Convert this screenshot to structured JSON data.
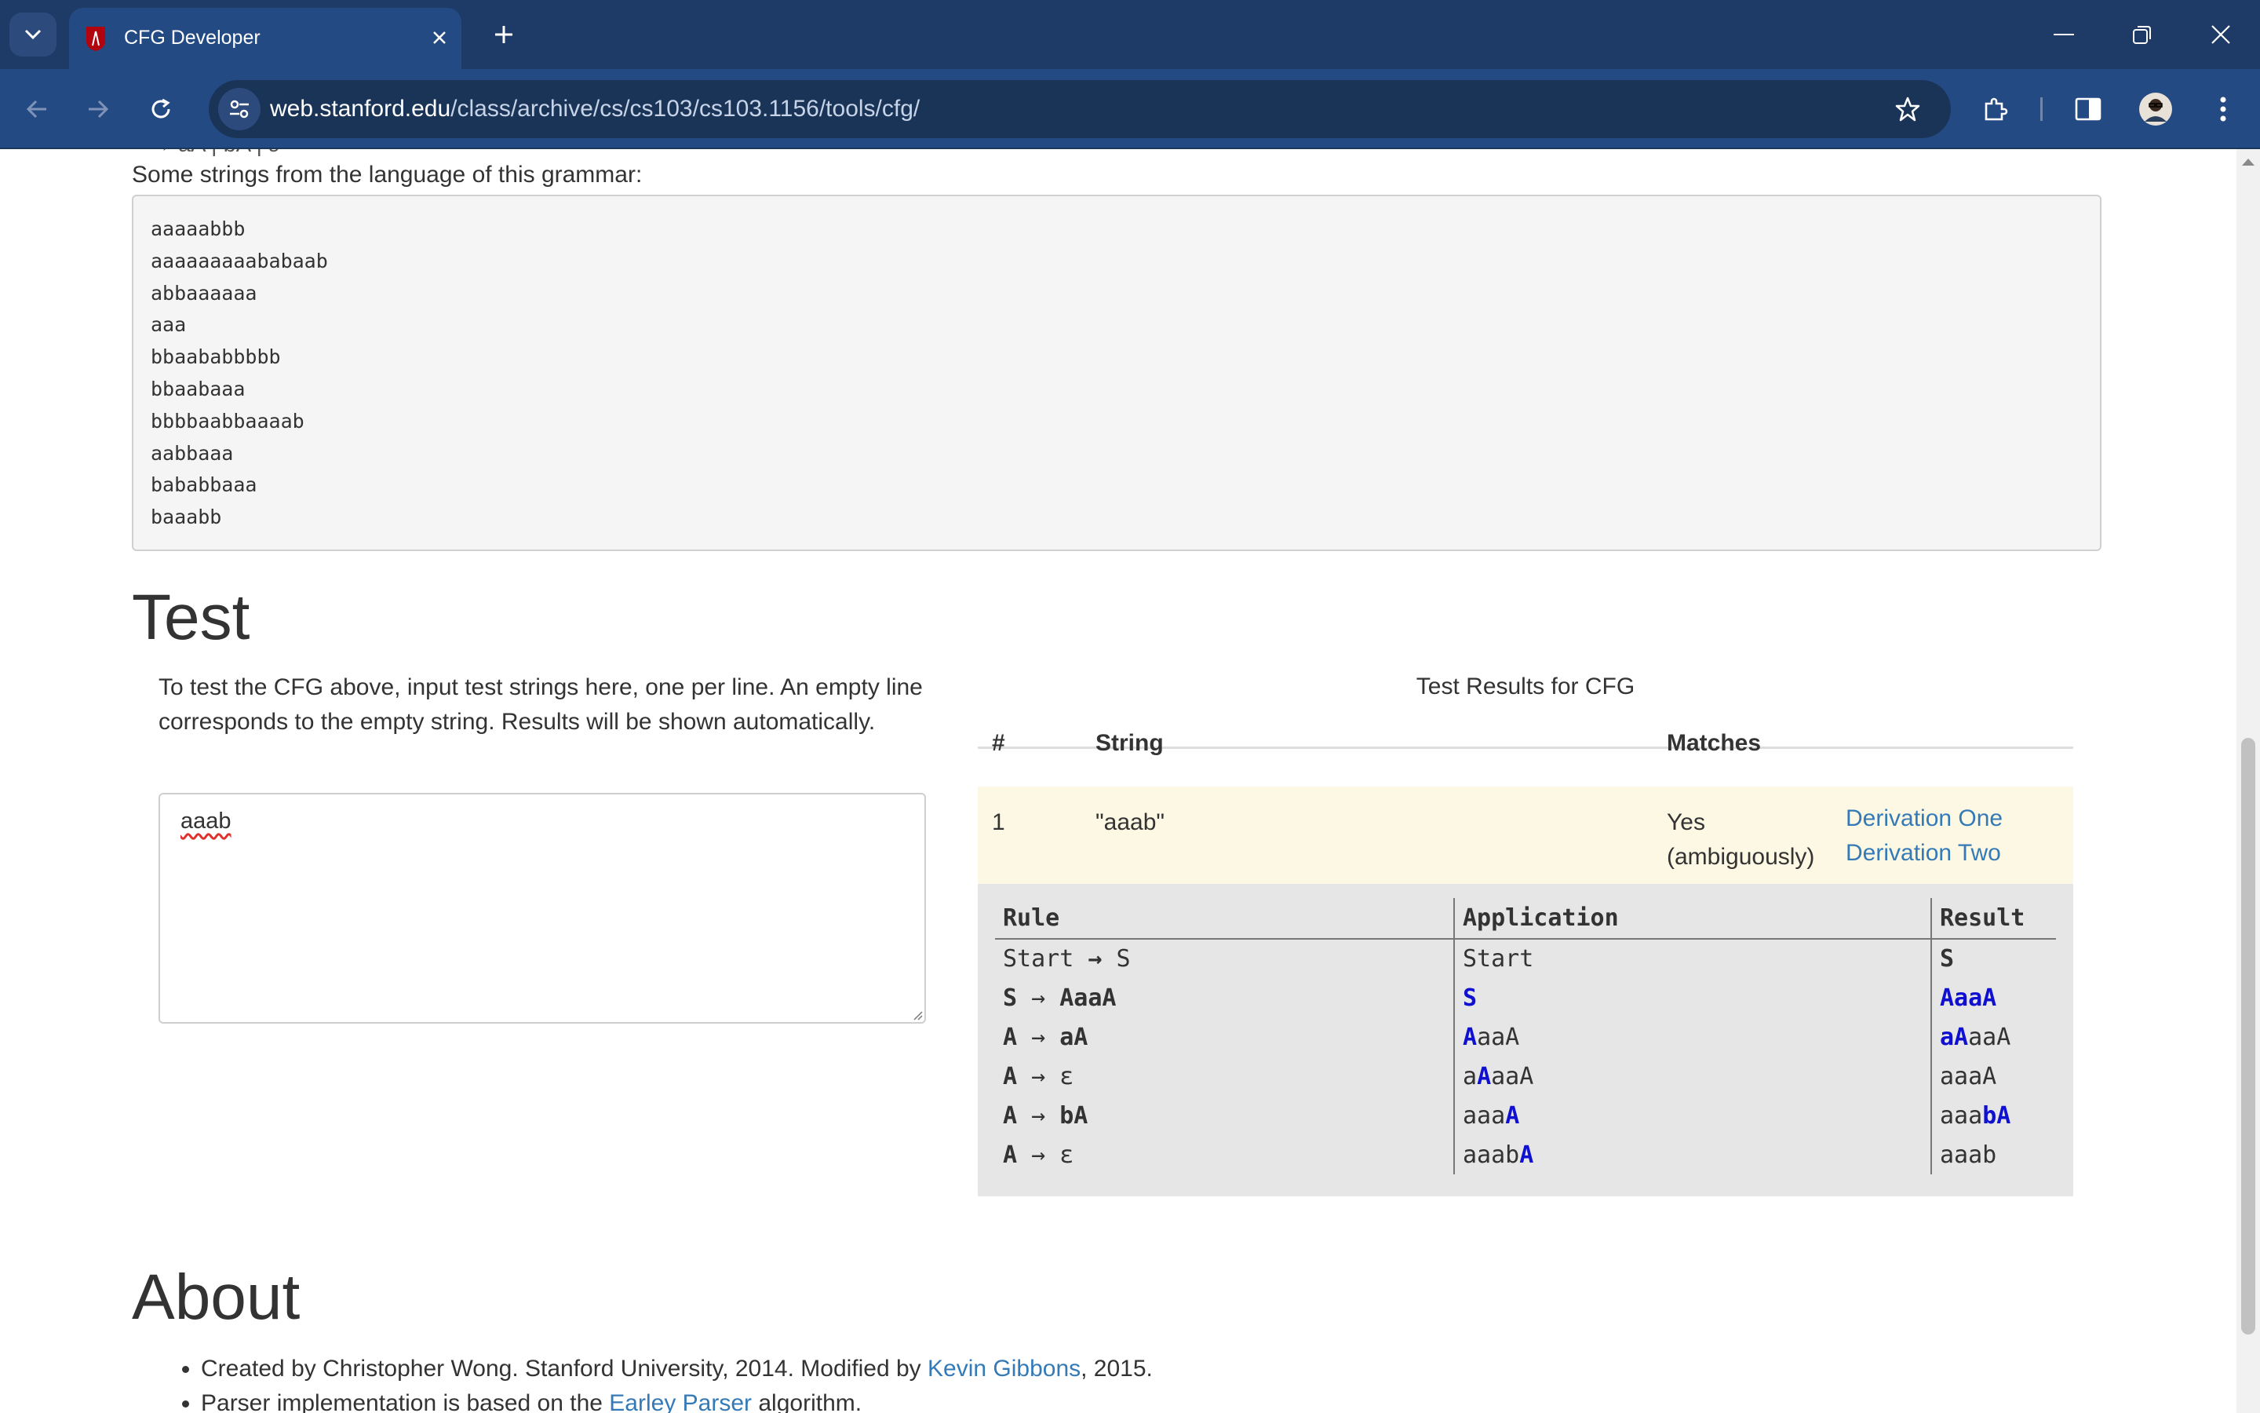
{
  "browser": {
    "tab_title": "CFG Developer",
    "url_host": "web.stanford.edu",
    "url_path": "/class/archive/cs/cs103/cs103.1156/tools/cfg/"
  },
  "grammar": {
    "cut_off_line": "→ aA | bA | ε",
    "strings_intro": "Some strings from the language of this grammar:",
    "sample_strings": [
      "aaaaabbb",
      "aaaaaaaaababaab",
      "abbaaaaaa",
      "aaa",
      "bbaababbbbb",
      "bbaabaaa",
      "bbbbaabbaaaab",
      "aabbaaa",
      "bababbaaa",
      "baaabb"
    ]
  },
  "test": {
    "heading": "Test",
    "instructions": "To test the CFG above, input test strings here, one per line. An empty line corresponds to the empty string. Results will be shown automatically.",
    "input_value": "aaab",
    "results_title": "Test Results for CFG",
    "columns": {
      "num": "#",
      "string": "String",
      "matches": "Matches"
    },
    "row": {
      "num": "1",
      "string": "\"aaab\"",
      "match_line1": "Yes",
      "match_line2": "(ambiguously)",
      "link1": "Derivation One",
      "link2": "Derivation Two"
    },
    "derivation": {
      "headers": {
        "rule": "Rule",
        "application": "Application",
        "result": "Result"
      },
      "steps": [
        {
          "rule": "Start → S",
          "application": "Start",
          "result": "S"
        },
        {
          "rule": "S → AaaA",
          "application": "S",
          "result": "AaaA"
        },
        {
          "rule": "A → aA",
          "application": "AaaA",
          "result": "aAaaA"
        },
        {
          "rule": "A → ε",
          "application": "aAaaA",
          "result": "aaaA"
        },
        {
          "rule": "A → bA",
          "application": "aaaA",
          "result": "aaabA"
        },
        {
          "rule": "A → ε",
          "application": "aaabA",
          "result": "aaab"
        }
      ]
    }
  },
  "about": {
    "heading": "About",
    "item1_prefix": "Created by Christopher Wong. Stanford University, 2014. Modified by ",
    "item1_link": "Kevin Gibbons",
    "item1_suffix": ", 2015.",
    "item2_prefix": "Parser implementation is based on the ",
    "item2_link": "Earley Parser",
    "item2_suffix": " algorithm."
  },
  "colors": {
    "link": "#337ab7",
    "highlight": "#1010d0",
    "row_highlight": "#fcf8e3",
    "chrome": "#244a83"
  }
}
